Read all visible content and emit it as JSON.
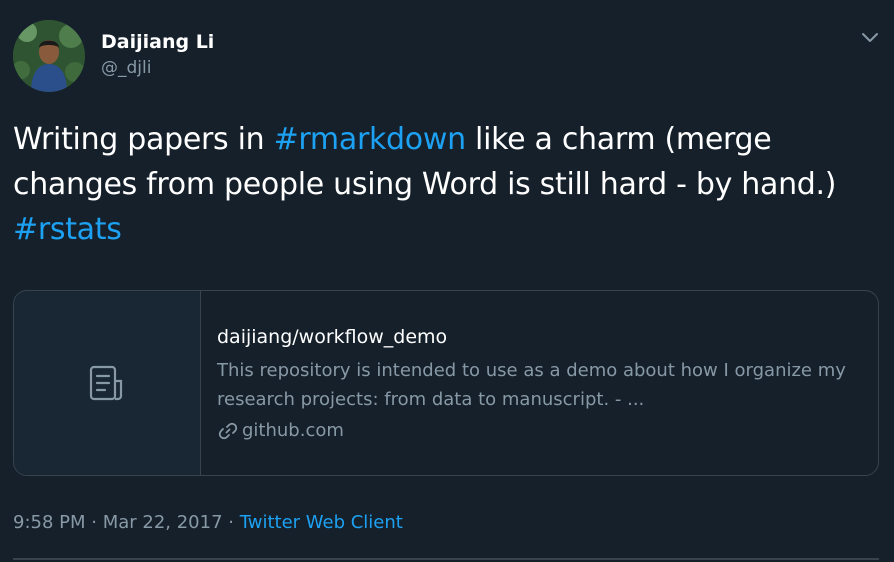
{
  "user": {
    "display_name": "Daijiang Li",
    "handle": "@_djli"
  },
  "tweet": {
    "text_1": "Writing papers in ",
    "hashtag_1": "#rmarkdown",
    "text_2": " like a charm (merge changes from people using Word is still hard - by hand.) ",
    "hashtag_2": "#rstats"
  },
  "card": {
    "title": "daijiang/workflow_demo",
    "description": "This repository is intended to use as a demo about how I organize my research projects: from data to manuscript. - ...",
    "domain": "github.com",
    "thumb_icon": "document-icon"
  },
  "meta": {
    "time": "9:58 PM",
    "date": "Mar 22, 2017",
    "separator": " · ",
    "source": "Twitter Web Client"
  },
  "colors": {
    "background": "#15202b",
    "accent": "#1da1f2",
    "secondary_text": "#8899a6",
    "border": "#38444d"
  }
}
